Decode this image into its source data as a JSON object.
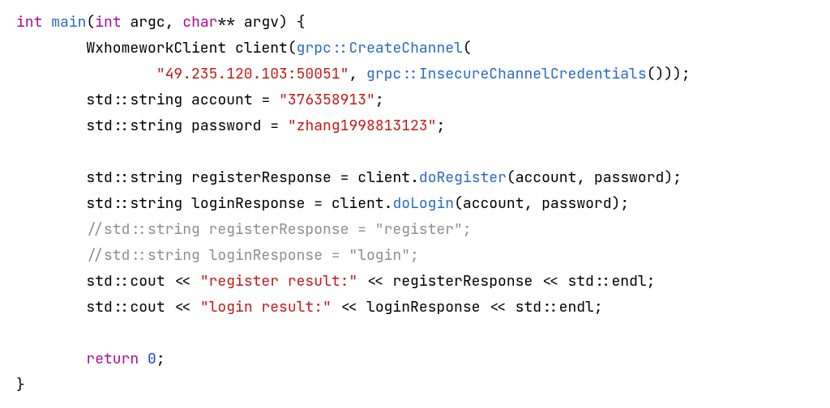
{
  "tokens": {
    "kw_int": "int",
    "kw_char": "char",
    "kw_return": "return",
    "fn_main": "main",
    "id_argc": "argc",
    "id_argv": "argv",
    "id_WxhomeworkClient": "WxhomeworkClient",
    "id_client": "client",
    "ns_grpc": "grpc",
    "fn_CreateChannel": "CreateChannel",
    "str_endpoint": "\"49.235.120.103:50051\"",
    "fn_InsecureChannelCredentials": "InsecureChannelCredentials",
    "ns_std": "std",
    "ty_string": "string",
    "id_account": "account",
    "str_account": "\"376358913\"",
    "id_password": "password",
    "str_password": "\"zhang1998813123\"",
    "id_registerResponse": "registerResponse",
    "fn_doRegister": "doRegister",
    "id_loginResponse": "loginResponse",
    "fn_doLogin": "doLogin",
    "cmt_register": "//std::string registerResponse = \"register\";",
    "cmt_login": "//std::string loginResponse = \"login\";",
    "id_cout": "cout",
    "str_reg_result": "\"register result:\"",
    "str_login_result": "\"login result:\"",
    "id_endl": "endl",
    "num_zero": "0"
  }
}
